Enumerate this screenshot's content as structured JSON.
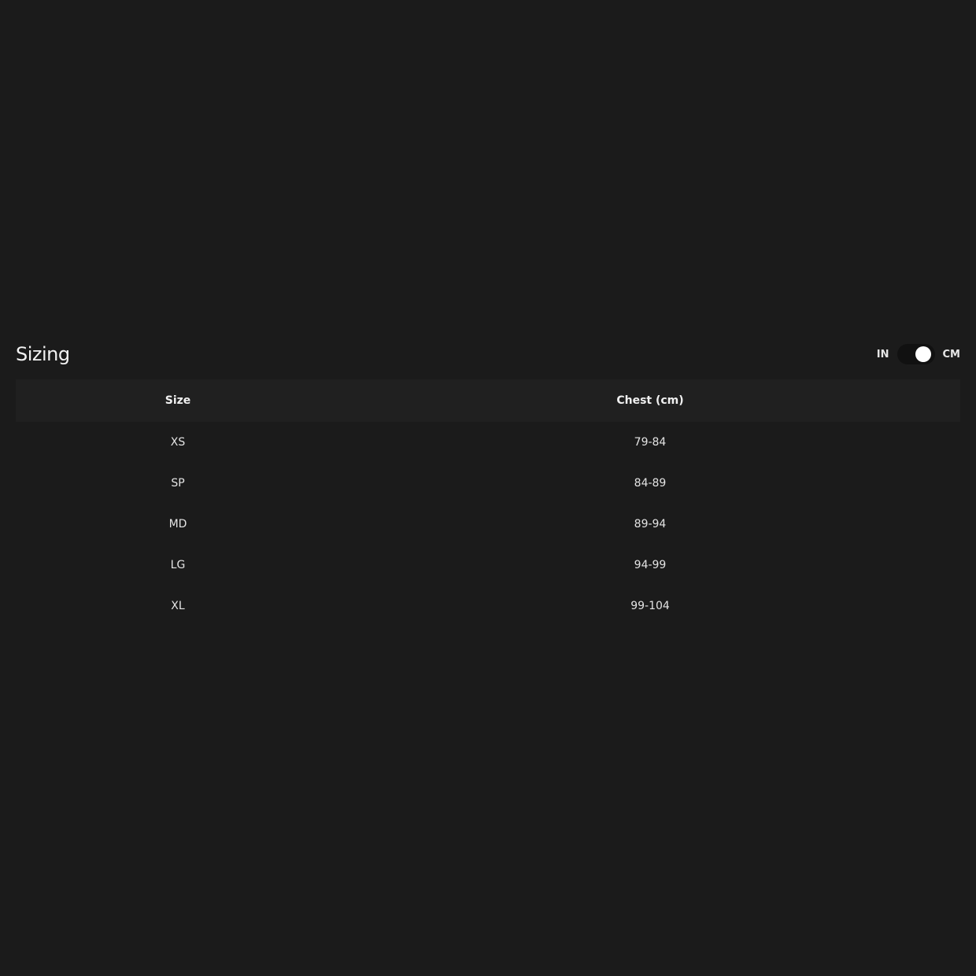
{
  "sizing": {
    "title": "Sizing",
    "toggle": {
      "left_label": "IN",
      "right_label": "CM",
      "selected": "CM"
    }
  },
  "table": {
    "headers": [
      "Size",
      "Chest (cm)"
    ],
    "rows": [
      [
        "XS",
        "79-84"
      ],
      [
        "SP",
        "84-89"
      ],
      [
        "MD",
        "89-94"
      ],
      [
        "LG",
        "94-99"
      ],
      [
        "XL",
        "99-104"
      ]
    ]
  },
  "colors": {
    "background": "#1b1b1b",
    "header_row": "#202020",
    "switch_track": "#111111",
    "switch_knob": "#ffffff"
  }
}
